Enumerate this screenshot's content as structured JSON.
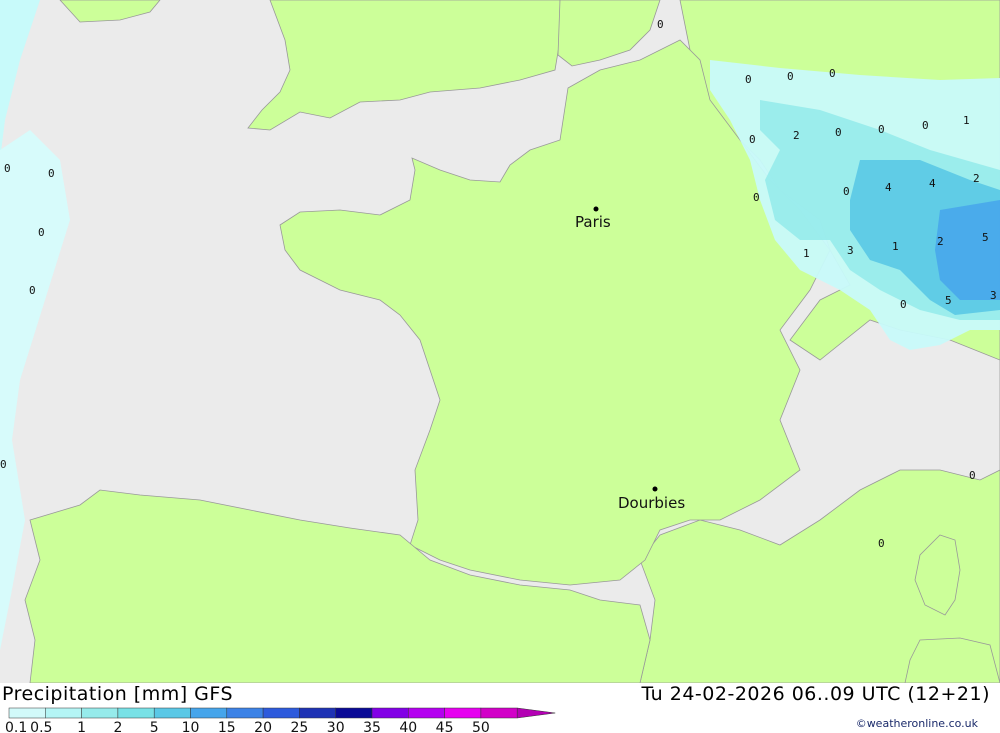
{
  "title": "Precipitation [mm] GFS",
  "valid_time": "Tu 24-02-2026 06..09 UTC (12+21)",
  "credit": "©weatheronline.co.uk",
  "cities": [
    {
      "name": "Paris"
    },
    {
      "name": "Dourbies"
    }
  ],
  "point_values": [
    "0",
    "0",
    "0",
    "0",
    "0",
    "0",
    "0",
    "0",
    "0",
    "0",
    "1",
    "0",
    "0",
    "2",
    "0",
    "4",
    "4",
    "2",
    "0",
    "3",
    "1",
    "2",
    "5",
    "1",
    "5",
    "3",
    "0",
    "0",
    "0",
    "0"
  ],
  "legend": {
    "ticks": [
      "0.1",
      "0.5",
      "1",
      "2",
      "5",
      "10",
      "15",
      "20",
      "25",
      "30",
      "35",
      "40",
      "45",
      "50"
    ],
    "colors": [
      "#d2fafa",
      "#b4f5f5",
      "#96ebeb",
      "#78e1e6",
      "#5ac8e6",
      "#46a5eb",
      "#3c82e6",
      "#2d5adc",
      "#1e32b4",
      "#0a0a96",
      "#8200e6",
      "#b400f0",
      "#e600f0",
      "#d200c8",
      "#b400b4"
    ]
  },
  "colors": {
    "sea": "#ebebeb",
    "land": "#ccff99",
    "border": "#999999",
    "precip_light": "#c8fafa",
    "precip_mid": "#78e1ec",
    "precip_heavy": "#46a5e6"
  }
}
